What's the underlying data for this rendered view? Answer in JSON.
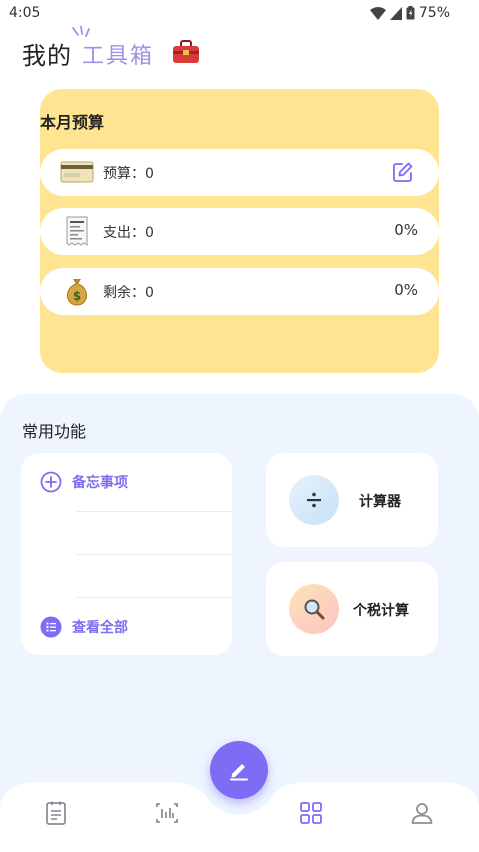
{
  "status_bar": {
    "time": "4:05",
    "battery": "75%"
  },
  "header": {
    "title": "我的",
    "accent": "工具箱"
  },
  "budget": {
    "title": "本月预算",
    "rows": [
      {
        "icon": "credit-card-icon",
        "label": "预算：0",
        "right": ""
      },
      {
        "icon": "receipt-icon",
        "label": "支出：0",
        "right": "0%"
      },
      {
        "icon": "money-bag-icon",
        "label": "剩余：0",
        "right": "0%"
      }
    ]
  },
  "functions": {
    "title": "常用功能",
    "memo": {
      "add_label": "备忘事项",
      "view_all_label": "查看全部"
    },
    "tools": [
      {
        "label": "计算器",
        "icon": "divide-icon",
        "color": "#d6ebfb"
      },
      {
        "label": "个税计算",
        "icon": "magnifier-icon",
        "color": "#fcd6c0"
      }
    ]
  },
  "colors": {
    "accent": "#7d6cf4",
    "budget_card": "#ffe591",
    "panel": "#eef5ff"
  },
  "nav": [
    "notes-icon",
    "chart-icon",
    "grid-icon",
    "profile-icon"
  ]
}
